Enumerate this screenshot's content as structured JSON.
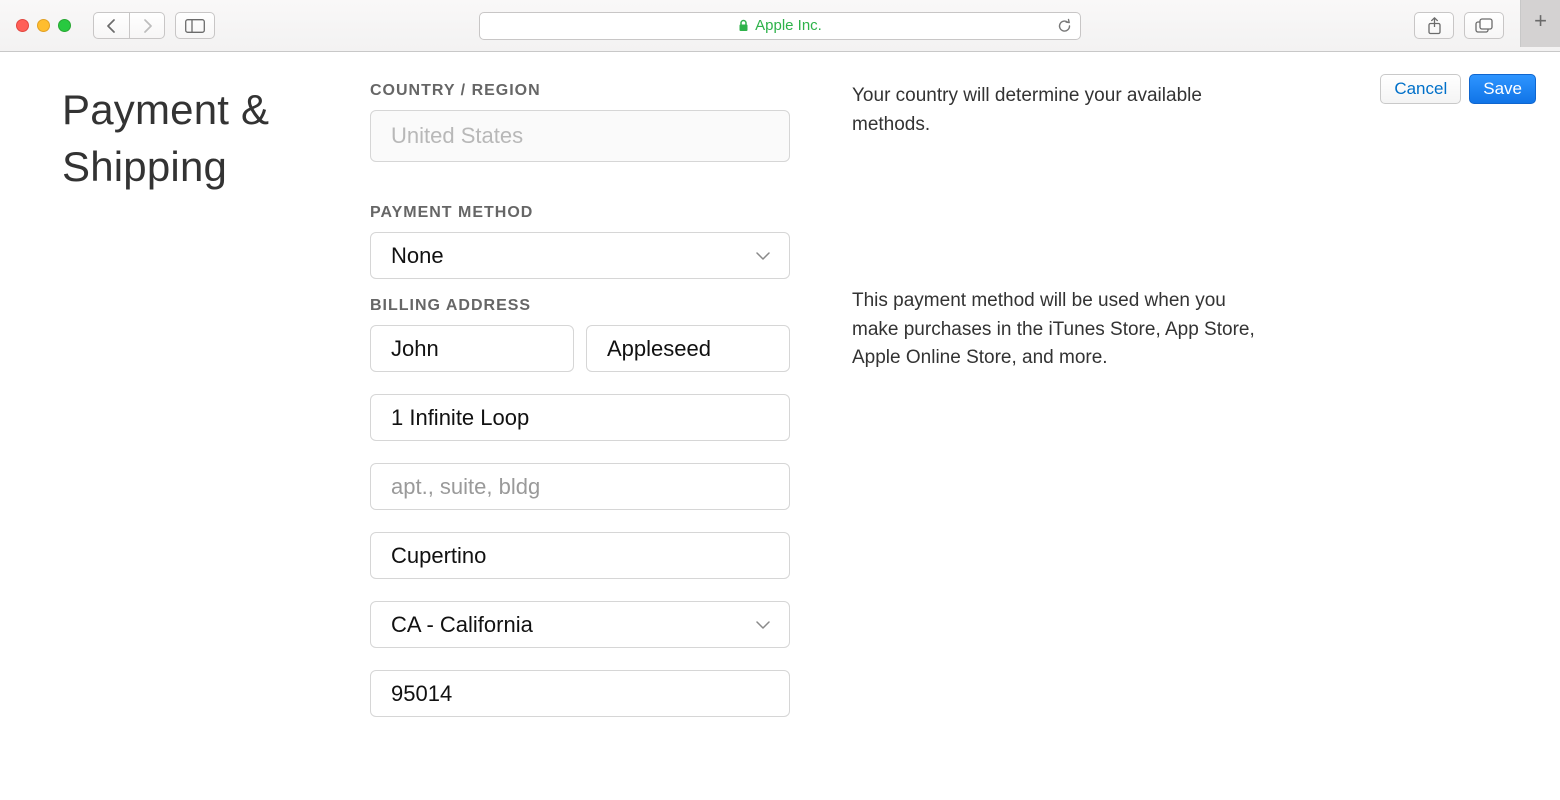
{
  "browser": {
    "site_label": "Apple Inc."
  },
  "page": {
    "title_line1": "Payment &",
    "title_line2": "Shipping"
  },
  "actions": {
    "cancel": "Cancel",
    "save": "Save"
  },
  "country_section": {
    "label": "COUNTRY / REGION",
    "value": "United States",
    "help": "Your country will determine your available methods."
  },
  "payment_section": {
    "label": "PAYMENT METHOD",
    "value": "None",
    "help": "This payment method will be used when you make purchases in the iTunes Store, App Store, Apple Online Store, and more."
  },
  "billing_section": {
    "label": "BILLING ADDRESS",
    "first_name": "John",
    "last_name": "Appleseed",
    "street1": "1 Infinite Loop",
    "street2_placeholder": "apt., suite, bldg",
    "city": "Cupertino",
    "state": "CA - California",
    "zip": "95014"
  }
}
